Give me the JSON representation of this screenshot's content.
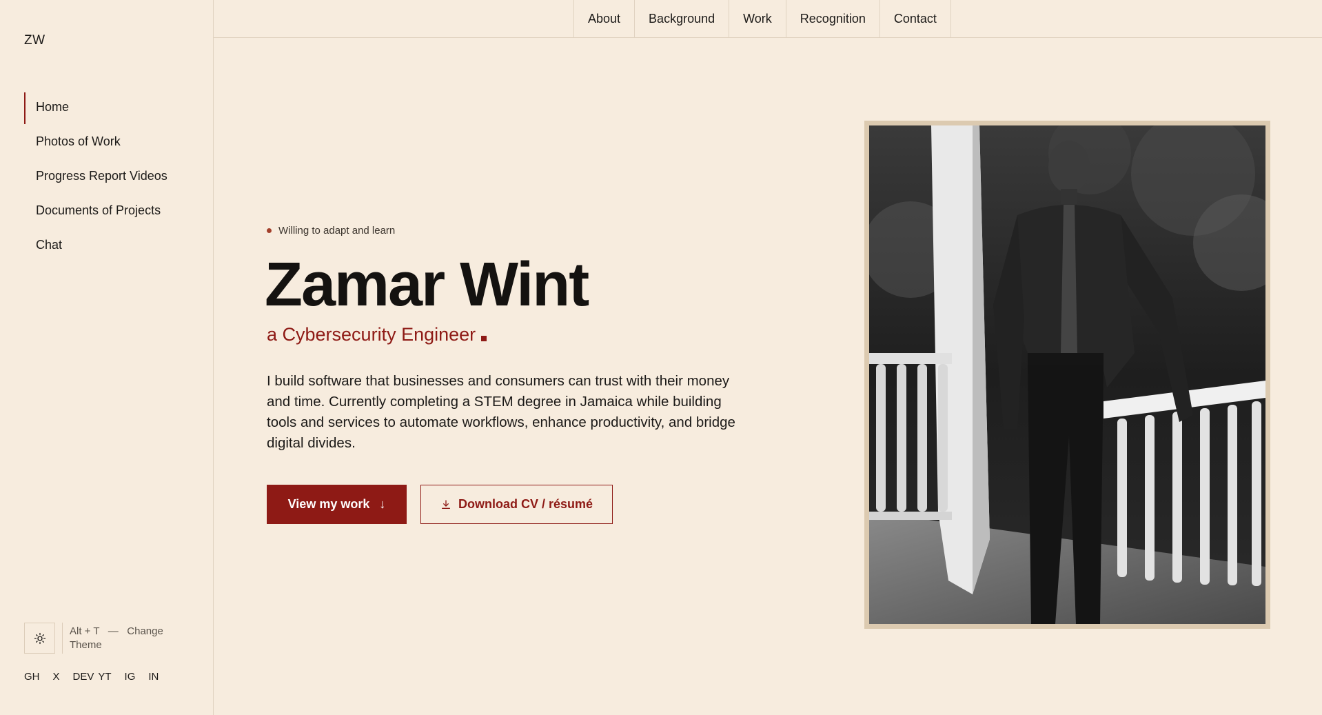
{
  "sidebar": {
    "logo": "ZW",
    "items": [
      {
        "label": "Home",
        "active": true
      },
      {
        "label": "Photos of Work"
      },
      {
        "label": "Progress Report Videos"
      },
      {
        "label": "Documents of Projects"
      },
      {
        "label": "Chat"
      }
    ],
    "theme": {
      "shortcut": "Alt + T",
      "separator": "—",
      "action": "Change Theme",
      "icon": "sun-icon"
    },
    "socials": [
      "GH",
      "X",
      "DEV",
      "YT",
      "IG",
      "IN"
    ]
  },
  "topnav": {
    "links": [
      "About",
      "Background",
      "Work",
      "Recognition",
      "Contact"
    ]
  },
  "hero": {
    "tagline": "Willing to adapt and learn",
    "name": "Zamar Wint",
    "role": "a Cybersecurity Engineer",
    "bio": "I build software that businesses and consumers can trust with their money and time. Currently completing a STEM degree in Jamaica while building tools and services to automate workflows, enhance productivity, and bridge digital divides.",
    "primary_button": "View my work",
    "primary_icon": "arrow-down-icon",
    "secondary_button": "Download CV / résumé",
    "secondary_icon": "download-icon"
  },
  "colors": {
    "background": "#f7ecde",
    "accent": "#8e1a15",
    "text": "#1c1a18",
    "border": "#e0d2c0",
    "frame": "#dccab0"
  }
}
